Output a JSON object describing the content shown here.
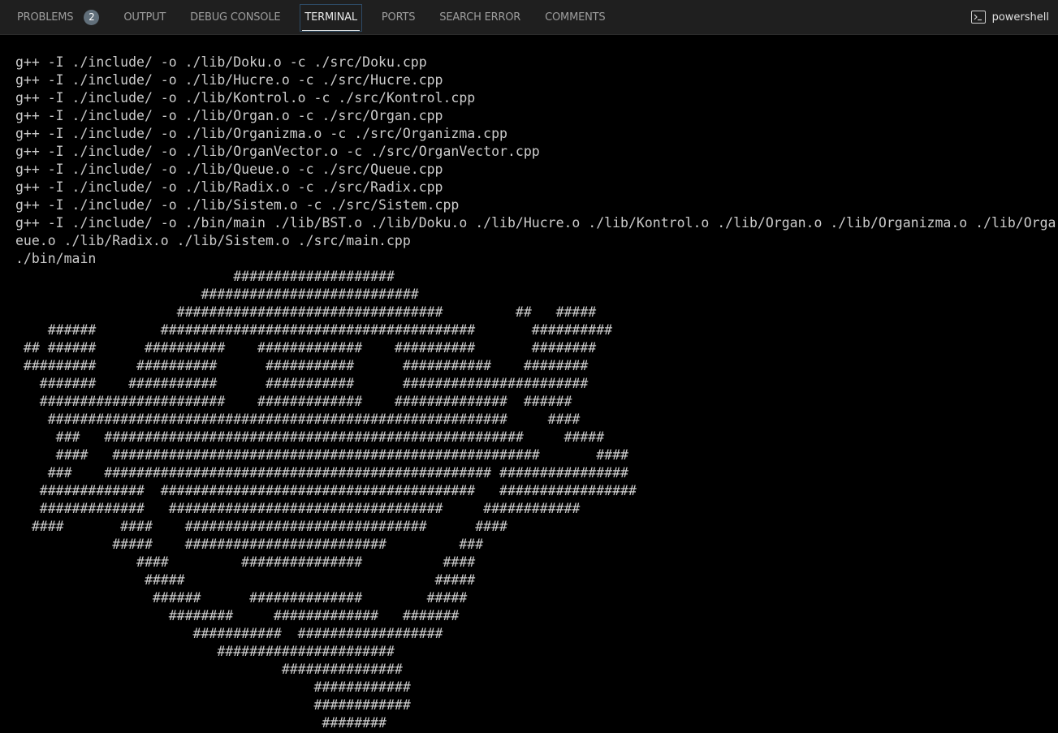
{
  "panel_tabs": {
    "problems": "PROBLEMS",
    "problems_count": "2",
    "output": "OUTPUT",
    "debug_console": "DEBUG CONSOLE",
    "terminal": "TERMINAL",
    "ports": "PORTS",
    "search_error": "SEARCH ERROR",
    "comments": "COMMENTS"
  },
  "active_tab": "TERMINAL",
  "shell": {
    "label": "powershell",
    "icon": "terminal-prompt-icon"
  },
  "colors": {
    "tabbar_bg": "#1f1f1f",
    "terminal_bg": "#000000",
    "terminal_text": "#cccccc",
    "badge_bg": "#616f7a"
  },
  "terminal": {
    "lines": [
      "g++ -I ./include/ -o ./lib/Doku.o -c ./src/Doku.cpp",
      "g++ -I ./include/ -o ./lib/Hucre.o -c ./src/Hucre.cpp",
      "g++ -I ./include/ -o ./lib/Kontrol.o -c ./src/Kontrol.cpp",
      "g++ -I ./include/ -o ./lib/Organ.o -c ./src/Organ.cpp",
      "g++ -I ./include/ -o ./lib/Organizma.o -c ./src/Organizma.cpp",
      "g++ -I ./include/ -o ./lib/OrganVector.o -c ./src/OrganVector.cpp",
      "g++ -I ./include/ -o ./lib/Queue.o -c ./src/Queue.cpp",
      "g++ -I ./include/ -o ./lib/Radix.o -c ./src/Radix.cpp",
      "g++ -I ./include/ -o ./lib/Sistem.o -c ./src/Sistem.cpp",
      "g++ -I ./include/ -o ./bin/main ./lib/BST.o ./lib/Doku.o ./lib/Hucre.o ./lib/Kontrol.o ./lib/Organ.o ./lib/Organizma.o ./lib/Orga",
      "eue.o ./lib/Radix.o ./lib/Sistem.o ./src/main.cpp",
      "./bin/main",
      "                           ####################",
      "                       ###########################",
      "                    #################################         ##   #####",
      "    ######        #######################################       ##########",
      " ## ######      ##########    #############    ##########       ########",
      " #########     ##########      ###########      ###########    ########",
      "   #######    ###########      ###########      #######################",
      "   #######################    #############    ##############  ######",
      "    #########################################################     ####",
      "     ###   ####################################################     #####",
      "     ####   #####################################################       ####",
      "    ###    ################################################ ################",
      "   #############  #######################################   #################",
      "   #############   ##################################     ############",
      "  ####       ####    ##############################      ####",
      "            #####    #########################         ###",
      "               ####         ###############          ####",
      "                #####                               #####",
      "                 ######      ##############        #####",
      "                   ########     #############   #######",
      "                      ###########  ##################",
      "                         ######################",
      "                                 ###############",
      "                                     ############",
      "                                     ############",
      "                                      ########"
    ]
  }
}
